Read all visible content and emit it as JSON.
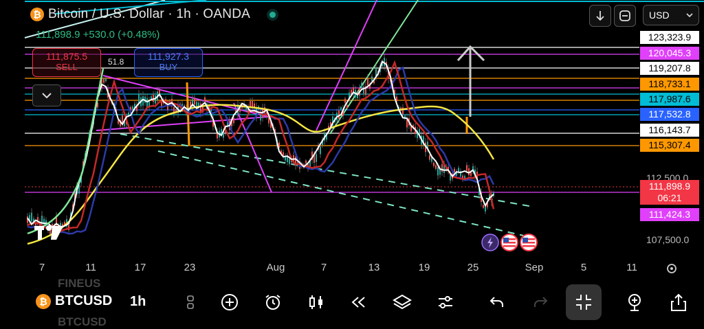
{
  "header": {
    "coin_glyph": "₿",
    "title": "Bitcoin / U.S. Dollar · 1h · OANDA",
    "change": "111,898.9  +530.0 (+0.48%)"
  },
  "trade": {
    "sell_price": "111,875.5",
    "sell_label": "SELL",
    "buy_price": "111,927.3",
    "buy_label": "BUY",
    "spread": "51.8"
  },
  "toolbar_top": {
    "currency": "USD"
  },
  "price_scale": {
    "labels": [
      {
        "text": "123,323.9",
        "bg": "#ffffff",
        "fg": "#000000"
      },
      {
        "text": "120,045.3",
        "bg": "#e040fb",
        "fg": "#ffffff"
      },
      {
        "text": "119,207.8",
        "bg": "#ffffff",
        "fg": "#000000"
      },
      {
        "text": "118,733.1",
        "bg": "#ff9800",
        "fg": "#000000"
      },
      {
        "text": "117,987.6",
        "bg": "#00bcd4",
        "fg": "#000000"
      },
      {
        "text": "117,532.8",
        "bg": "#2962ff",
        "fg": "#ffffff"
      },
      {
        "text": "116,143.7",
        "bg": "#ffffff",
        "fg": "#000000"
      },
      {
        "text": "115,307.4",
        "bg": "#ff9800",
        "fg": "#000000"
      }
    ],
    "tick_112500": "112,500.0",
    "current_price": "111,898.9",
    "countdown": "06:21",
    "low_label": "111,424.3",
    "tick_107500": "107,500.0"
  },
  "x_axis": {
    "labels": [
      "7",
      "11",
      "17",
      "23",
      "Aug",
      "7",
      "13",
      "19",
      "25",
      "Sep",
      "5",
      "11"
    ]
  },
  "bottom_bar": {
    "symbol": "BTCUSD",
    "timeframe": "1h",
    "ghost_top": "FINEUS",
    "ghost_bottom": "BTCUSD"
  },
  "colors": {
    "accent_green": "#2ebd85",
    "accent_red": "#f23645",
    "blue": "#2962ff"
  }
}
